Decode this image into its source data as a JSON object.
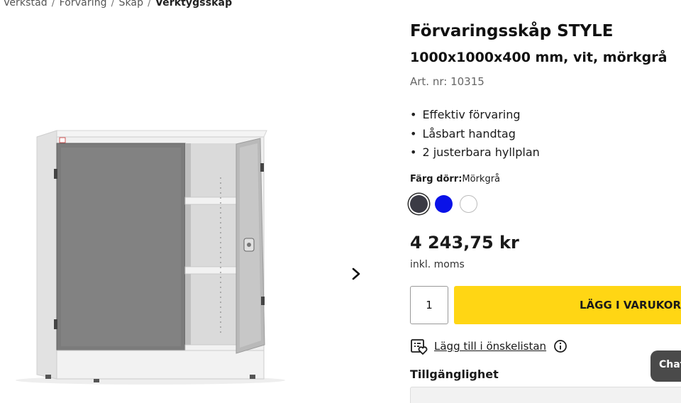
{
  "breadcrumb": {
    "items": [
      "k Verkstad",
      "Förvaring",
      "Skåp"
    ],
    "current": "Verktygsskåp",
    "separator": "/"
  },
  "gallery": {
    "next_icon": "chevron-right-icon"
  },
  "product": {
    "title": "Förvaringsskåp STYLE",
    "subtitle": "1000x1000x400 mm, vit, mörkgrå",
    "art_nr": "Art. nr: 10315",
    "features": [
      "Effektiv förvaring",
      "Låsbart handtag",
      "2 justerbara hyllplan"
    ]
  },
  "color": {
    "label": "Färg dörr:",
    "value": "Mörkgrå",
    "swatches": [
      {
        "name": "dark-grey",
        "hex": "#3b3b45",
        "selected": true
      },
      {
        "name": "blue",
        "hex": "#0a12e8",
        "selected": false
      },
      {
        "name": "white",
        "hex": "#ffffff",
        "selected": false
      }
    ]
  },
  "price": {
    "amount": "4 243,75 kr",
    "vat": "inkl. moms"
  },
  "cart": {
    "quantity": "1",
    "add_label": "LÄGG I VARUKORG",
    "accent": "#ffd614"
  },
  "wishlist": {
    "label": "Lägg till i önskelistan",
    "icon": "wishlist-icon",
    "info_icon": "info-icon"
  },
  "availability": {
    "label": "Tillgänglighet"
  },
  "chat": {
    "label": "Chat"
  }
}
